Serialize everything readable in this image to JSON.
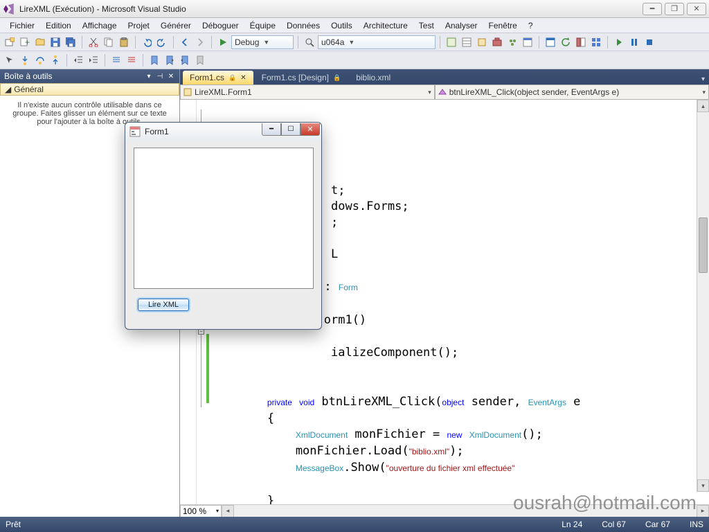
{
  "window": {
    "title": "LireXML (Exécution) - Microsoft Visual Studio"
  },
  "menu": [
    "Fichier",
    "Edition",
    "Affichage",
    "Projet",
    "Générer",
    "Déboguer",
    "Équipe",
    "Données",
    "Outils",
    "Architecture",
    "Test",
    "Analyser",
    "Fenêtre",
    "?"
  ],
  "toolbar": {
    "configuration": "Debug",
    "platform": "u064a"
  },
  "toolbox": {
    "title": "Boîte à outils",
    "category": "Général",
    "empty_msg": "Il n'existe aucun contrôle utilisable dans ce groupe. Faites glisser un élément sur ce texte pour l'ajouter à la boîte à outils."
  },
  "tabs": [
    {
      "label": "Form1.cs",
      "active": true,
      "locked": true
    },
    {
      "label": "Form1.cs [Design]",
      "active": false,
      "locked": true
    },
    {
      "label": "biblio.xml",
      "active": false,
      "locked": false
    }
  ],
  "nav": {
    "class": "LireXML.Form1",
    "member": "btnLireXML_Click(object sender, EventArgs e)"
  },
  "zoom": "100 %",
  "status": {
    "ready": "Prêt",
    "ln": "Ln 24",
    "col": "Col 67",
    "car": "Car 67",
    "ins": "INS"
  },
  "form_window": {
    "title": "Form1",
    "button": "Lire XML"
  },
  "watermark": "ousrah@hotmail.com",
  "code_strings": {
    "biblio": "\"biblio.xml\"",
    "ouverture": "\"ouverture du fichier xml effectuée\""
  }
}
